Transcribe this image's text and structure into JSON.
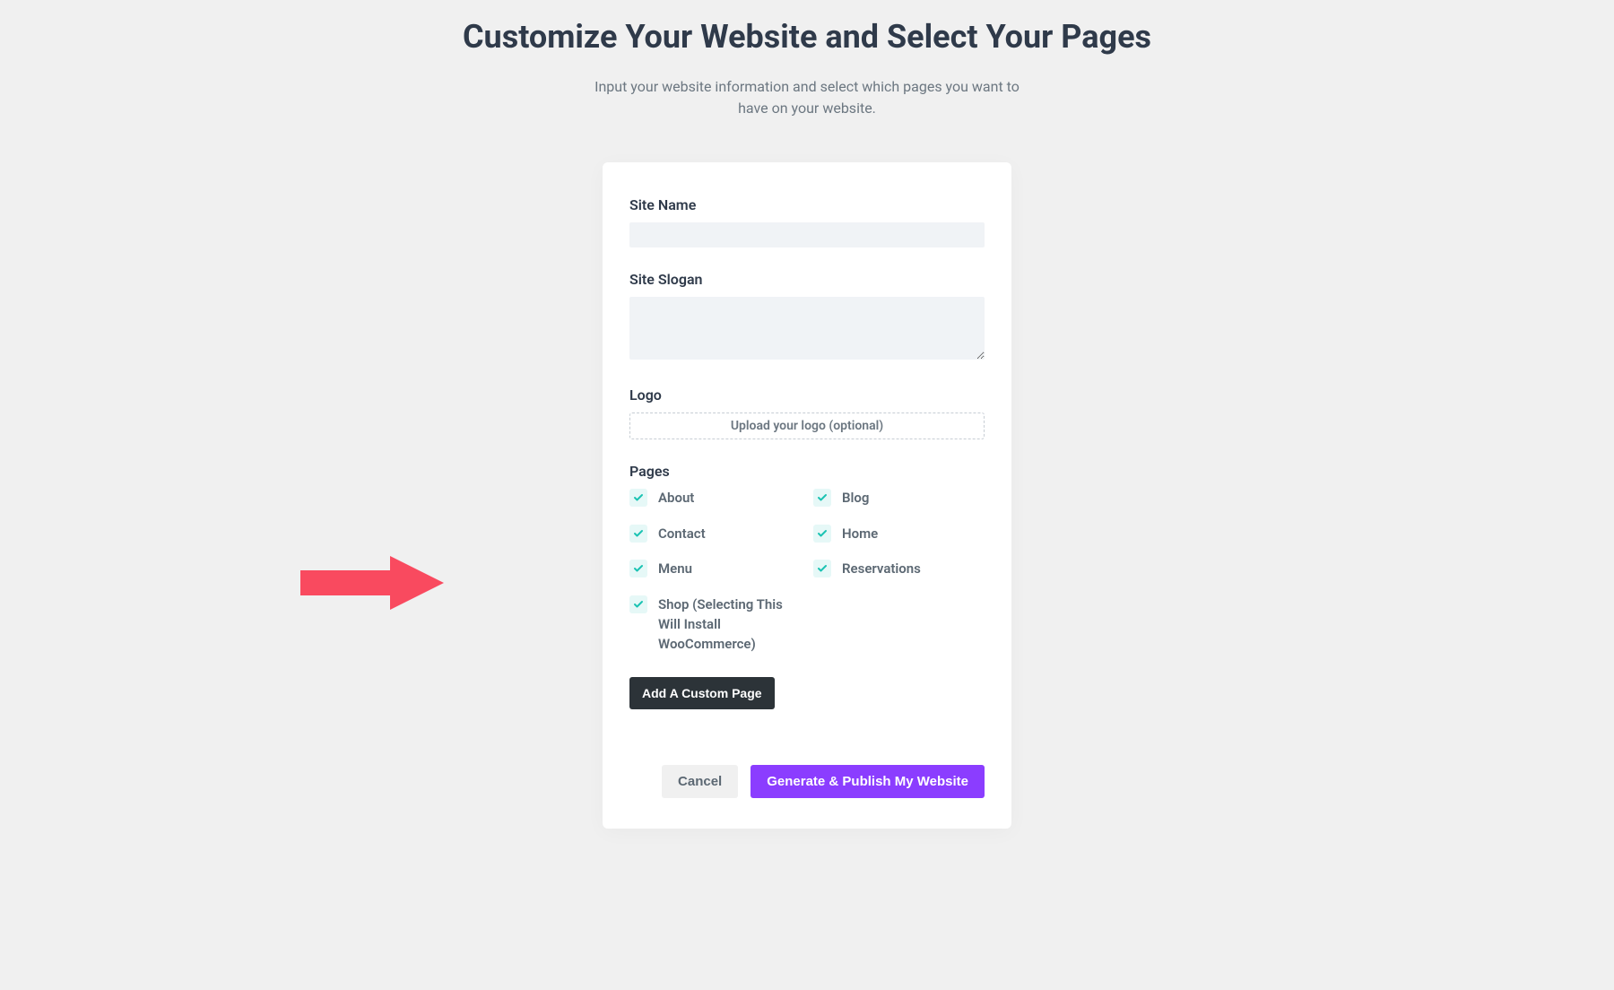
{
  "header": {
    "title": "Customize Your Website and Select Your Pages",
    "subtitle": "Input your website information and select which pages you want to have on your website."
  },
  "form": {
    "site_name": {
      "label": "Site Name",
      "value": ""
    },
    "site_slogan": {
      "label": "Site Slogan",
      "value": ""
    },
    "logo": {
      "label": "Logo",
      "upload_text": "Upload your logo (optional)"
    },
    "pages": {
      "label": "Pages",
      "items": [
        {
          "label": "About",
          "checked": true
        },
        {
          "label": "Blog",
          "checked": true
        },
        {
          "label": "Contact",
          "checked": true
        },
        {
          "label": "Home",
          "checked": true
        },
        {
          "label": "Menu",
          "checked": true
        },
        {
          "label": "Reservations",
          "checked": true
        },
        {
          "label": "Shop (Selecting This Will Install WooCommerce)",
          "checked": true
        }
      ]
    },
    "add_custom_page_label": "Add A Custom Page",
    "cancel_label": "Cancel",
    "generate_label": "Generate & Publish My Website"
  },
  "colors": {
    "accent": "#8b3dff",
    "check": "#1bc3b3",
    "arrow": "#f94a5f"
  }
}
